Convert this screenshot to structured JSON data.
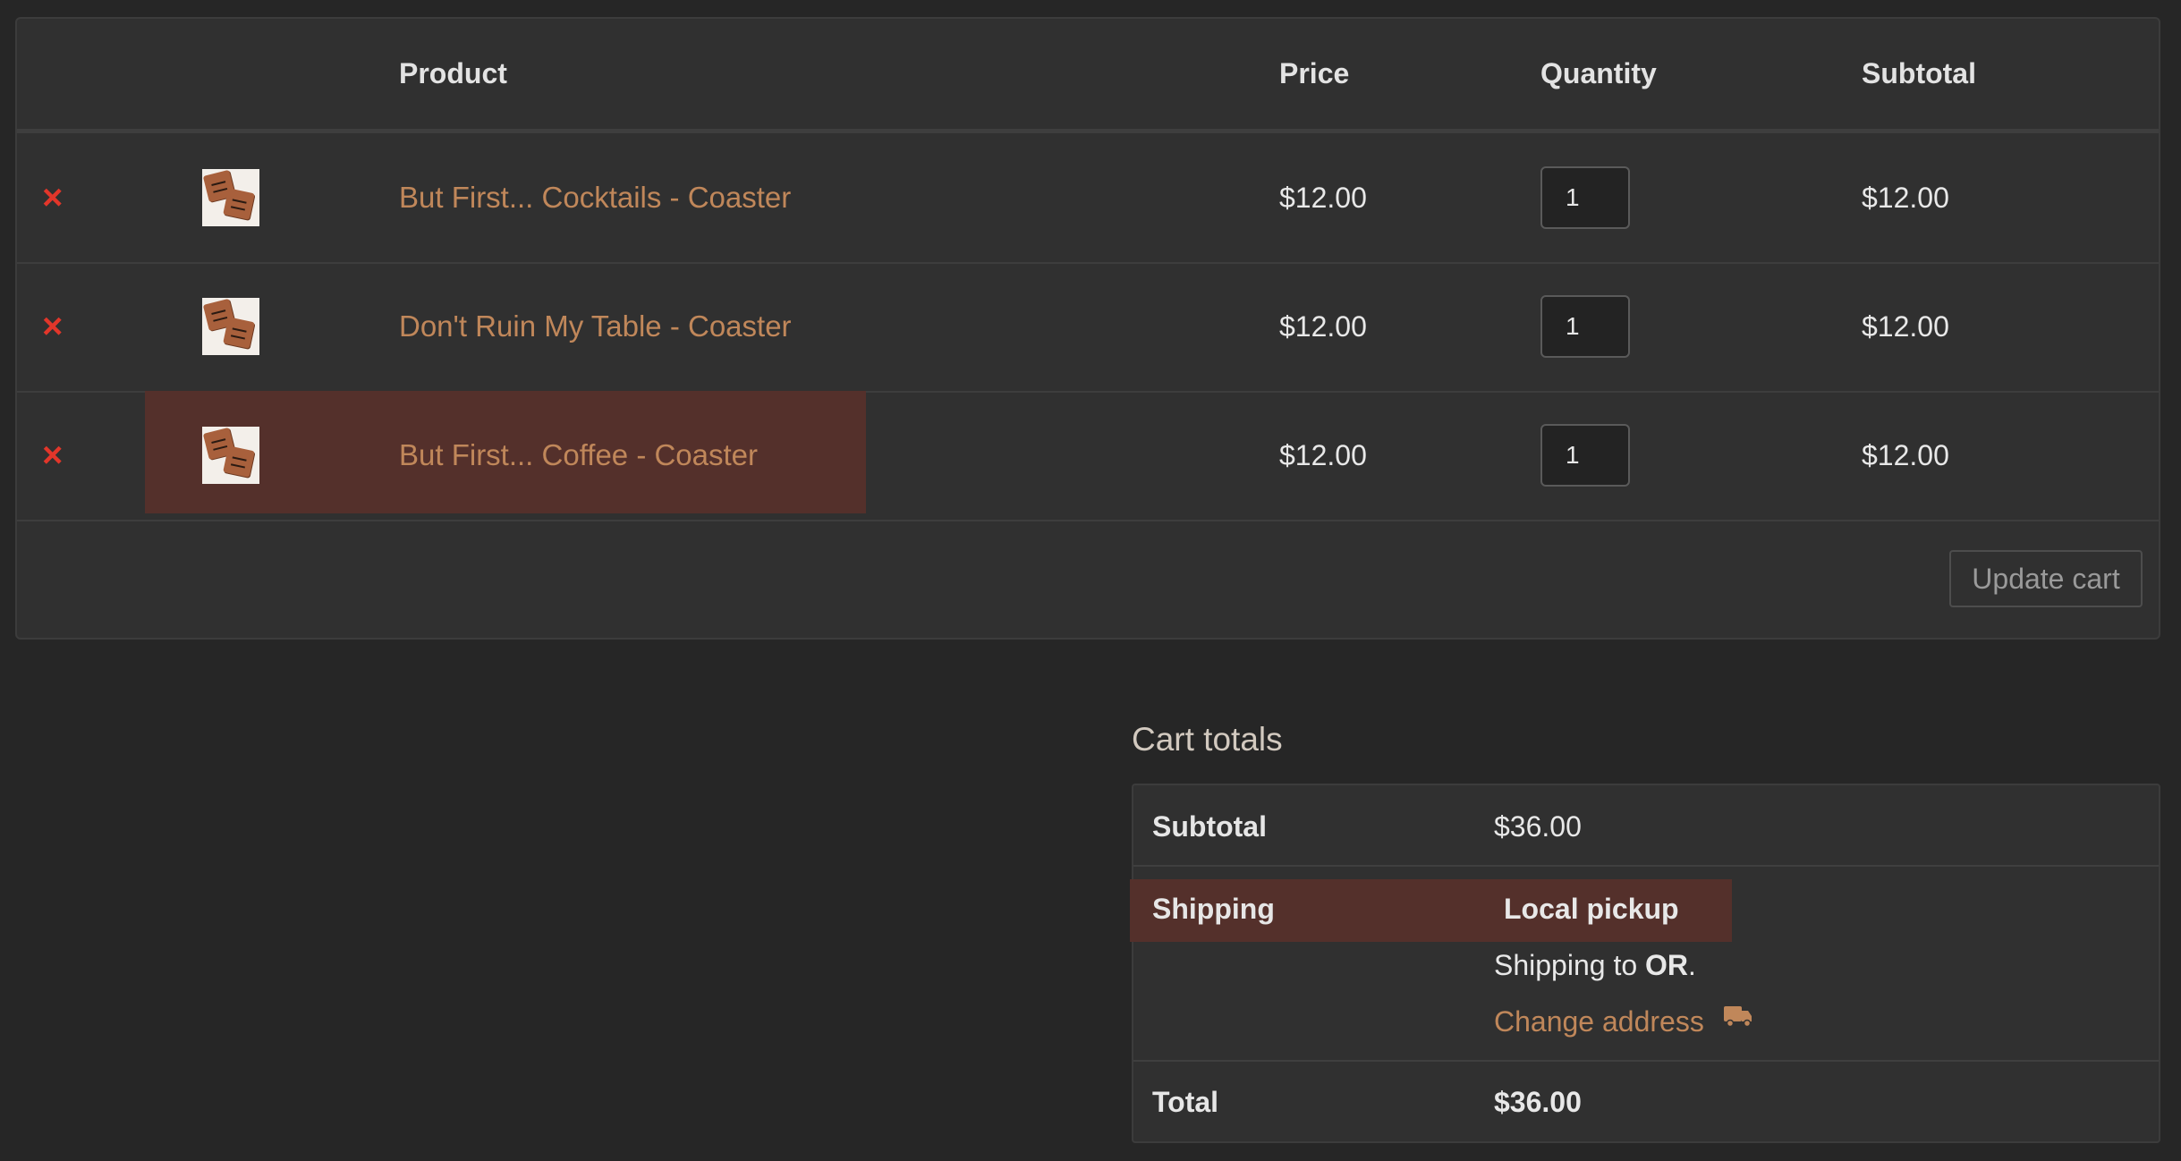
{
  "cart": {
    "columns": {
      "product": "Product",
      "price": "Price",
      "quantity": "Quantity",
      "subtotal": "Subtotal"
    },
    "remove_icon": "×",
    "items": [
      {
        "name": "But First... Cocktails - Coaster",
        "price": "$12.00",
        "quantity": "1",
        "subtotal": "$12.00"
      },
      {
        "name": "Don't Ruin My Table - Coaster",
        "price": "$12.00",
        "quantity": "1",
        "subtotal": "$12.00"
      },
      {
        "name": "But First... Coffee - Coaster",
        "price": "$12.00",
        "quantity": "1",
        "subtotal": "$12.00"
      }
    ],
    "update_label": "Update cart"
  },
  "totals": {
    "title": "Cart totals",
    "subtotal_label": "Subtotal",
    "subtotal_value": "$36.00",
    "shipping_label": "Shipping",
    "shipping_method": "Local pickup",
    "shipping_to_prefix": "Shipping to ",
    "shipping_to_region": "OR",
    "shipping_to_suffix": ".",
    "change_address": "Change address",
    "change_address_icon": "truck-icon",
    "total_label": "Total",
    "total_value": "$36.00"
  },
  "colors": {
    "background": "#262626",
    "panel": "#303030",
    "link": "#c0875a",
    "remove": "#e2362a",
    "highlight": "#54302b"
  }
}
